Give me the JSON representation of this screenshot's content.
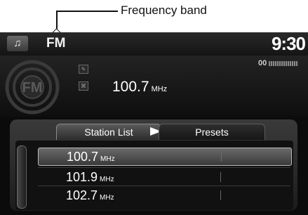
{
  "annotation": {
    "label": "Frequency band"
  },
  "header": {
    "music_icon": "music-note-icon",
    "music_glyph": "♫",
    "band": "FM",
    "clock": "9:30"
  },
  "now_playing": {
    "logo_icon": "fm-radio-icon",
    "logo_text": "FM",
    "frequency": "100.7",
    "unit": "MHz",
    "signal_icon": "signal-strength-icon",
    "signal_value": "00"
  },
  "tabs": [
    {
      "label": "Station List",
      "selected": true
    },
    {
      "label": "Presets",
      "selected": false
    }
  ],
  "stations": [
    {
      "frequency": "100.7",
      "unit": "MHz",
      "selected": true
    },
    {
      "frequency": "101.9",
      "unit": "MHz",
      "selected": false
    },
    {
      "frequency": "102.7",
      "unit": "MHz",
      "selected": false
    }
  ],
  "colors": {
    "background": "#0b0b0b",
    "text": "#ffffff",
    "selected_row": "#5a5a5a"
  }
}
